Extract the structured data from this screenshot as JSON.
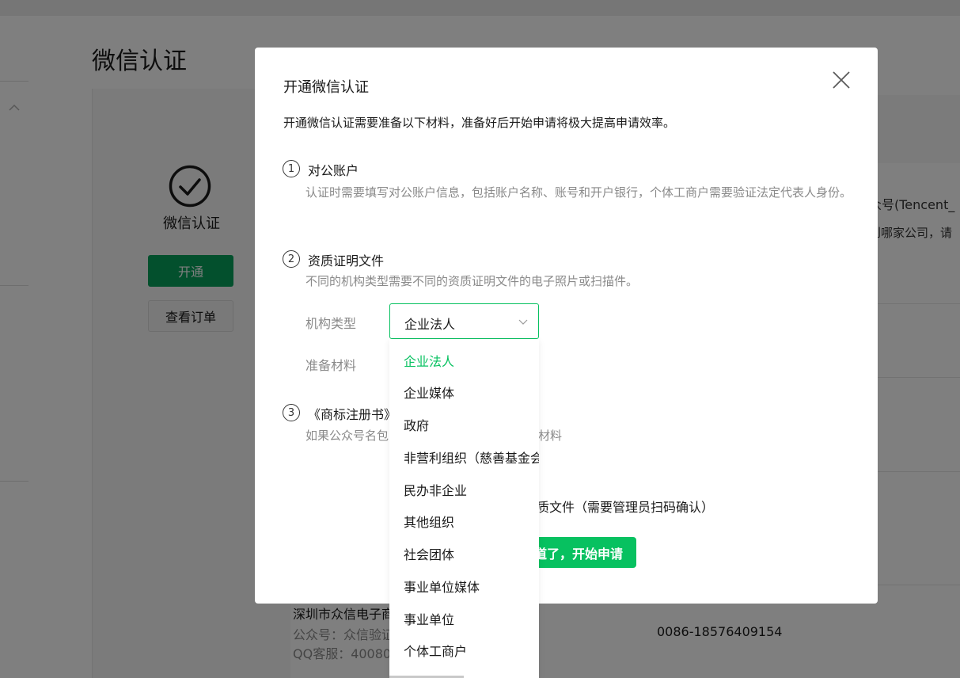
{
  "background": {
    "page_title": "微信认证",
    "card_label": "微信认证",
    "open_button": "开通",
    "orders_button": "查看订单",
    "right_text_1": "众号(Tencent_",
    "right_text_2": "到哪家公司，请",
    "footer": {
      "company": "深圳市众信电子商",
      "account": "公众号：众信验证",
      "qq": "QQ客服：40080",
      "phone": "0086-18576409154"
    }
  },
  "dialog": {
    "title": "开通微信认证",
    "intro": "开通微信认证需要准备以下材料，准备好后开始申请将极大提高申请效率。",
    "sections": [
      {
        "num": "1",
        "title": "对公账户",
        "desc": "认证时需要填写对公账户信息，包括账户名称、账号和开户银行，个体工商户需要验证法定代表人身份。"
      },
      {
        "num": "2",
        "title": "资质证明文件",
        "desc": "不同的机构类型需要不同的资质证明文件的电子照片或扫描件。",
        "org_type_label": "机构类型",
        "org_type_value": "企业法人",
        "materials_label": "准备材料"
      },
      {
        "num": "3",
        "title": "《商标注册书》",
        "desc_visible_left": "如果公众号名包",
        "desc_visible_right": "材料"
      }
    ],
    "checkbox_text": "质文件（需要管理员扫码确认）",
    "start_button": "道了，开始申请"
  },
  "dropdown": {
    "options": [
      {
        "label": "企业法人",
        "selected": true
      },
      {
        "label": "企业媒体",
        "selected": false
      },
      {
        "label": "政府",
        "selected": false
      },
      {
        "label": "非营利组织（慈善基金会",
        "selected": false
      },
      {
        "label": "民办非企业",
        "selected": false
      },
      {
        "label": "其他组织",
        "selected": false
      },
      {
        "label": "社会团体",
        "selected": false
      },
      {
        "label": "事业单位媒体",
        "selected": false
      },
      {
        "label": "事业单位",
        "selected": false
      },
      {
        "label": "个体工商户",
        "selected": false
      }
    ]
  },
  "colors": {
    "brand_green": "#07c160",
    "dark_green": "#07a05b",
    "overlay": "rgba(0,0,0,0.5)"
  },
  "icons": [
    "chevron-up-icon",
    "check-circle-icon",
    "close-icon",
    "chevron-down-icon"
  ]
}
